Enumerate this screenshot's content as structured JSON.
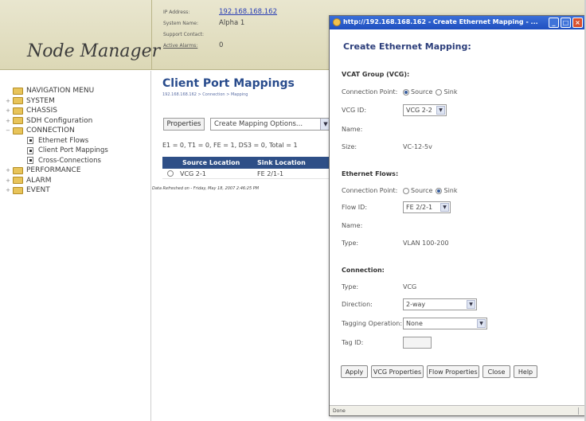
{
  "app": {
    "title": "Node Manager"
  },
  "node_info": [
    {
      "label": "IP Address:",
      "value": "192.168.168.162",
      "link": true
    },
    {
      "label": "System Name:",
      "value": "Alpha 1",
      "link": false
    },
    {
      "label": "Support Contact:",
      "value": "",
      "link": false
    },
    {
      "label": "Active Alarms:",
      "value": "0",
      "link": false
    }
  ],
  "nav": {
    "header": "NAVIGATION MENU",
    "items": [
      {
        "label": "SYSTEM",
        "expander": "+"
      },
      {
        "label": "CHASSIS",
        "expander": "+"
      },
      {
        "label": "SDH Configuration",
        "expander": "+"
      },
      {
        "label": "CONNECTION",
        "expander": "−"
      },
      {
        "label": "PERFORMANCE",
        "expander": "+"
      },
      {
        "label": "ALARM",
        "expander": "+"
      },
      {
        "label": "EVENT",
        "expander": "+"
      }
    ],
    "connection_children": [
      "Ethernet Flows",
      "Client Port Mappings",
      "Cross-Connections"
    ]
  },
  "main": {
    "title": "Client Port Mappings",
    "breadcrumb": "192.168.168.162 > Connection > Mapping",
    "properties_button": "Properties",
    "mapping_options": "Create Mapping Options...",
    "summary": "E1 = 0, T1 = 0, FE = 1, DS3 = 0, Total = 1",
    "table": {
      "headers": [
        "Source Location",
        "Sink Location"
      ],
      "rows": [
        {
          "source": "VCG 2-1",
          "sink": "FE 2/1-1",
          "selected": false
        }
      ]
    },
    "refreshed": "Data Refreshed on - Friday, May 18, 2007 2:46:25 PM"
  },
  "popup": {
    "window_title": "http://192.168.168.162 - Create Ethernet Mapping - ...",
    "heading": "Create Ethernet Mapping:",
    "vcat": {
      "title": "VCAT Group (VCG):",
      "connection_point_label": "Connection Point:",
      "source_label": "Source",
      "sink_label": "Sink",
      "selected": "Source",
      "vcg_id_label": "VCG ID:",
      "vcg_id_value": "VCG 2-2",
      "name_label": "Name:",
      "size_label": "Size:",
      "size_value": "VC-12-5v"
    },
    "ethernet": {
      "title": "Ethernet Flows:",
      "connection_point_label": "Connection Point:",
      "source_label": "Source",
      "sink_label": "Sink",
      "selected": "Sink",
      "flow_id_label": "Flow ID:",
      "flow_id_value": "FE 2/2-1",
      "name_label": "Name:",
      "type_label": "Type:",
      "type_value": "VLAN 100-200"
    },
    "connection": {
      "title": "Connection:",
      "type_label": "Type:",
      "type_value": "VCG",
      "direction_label": "Direction:",
      "direction_value": "2-way",
      "tagging_label": "Tagging Operation:",
      "tagging_value": "None",
      "tag_id_label": "Tag ID:"
    },
    "buttons": {
      "apply": "Apply",
      "vcg_properties": "VCG Properties",
      "flow_properties": "Flow Properties",
      "close": "Close",
      "help": "Help"
    },
    "status": "Done",
    "window_buttons": [
      "_",
      "□",
      "×"
    ]
  },
  "colors": {
    "header_bg": "#e2dec0",
    "title_blue": "#284b8c",
    "table_header": "#2e4f87",
    "titlebar": "#2a5ccc"
  }
}
